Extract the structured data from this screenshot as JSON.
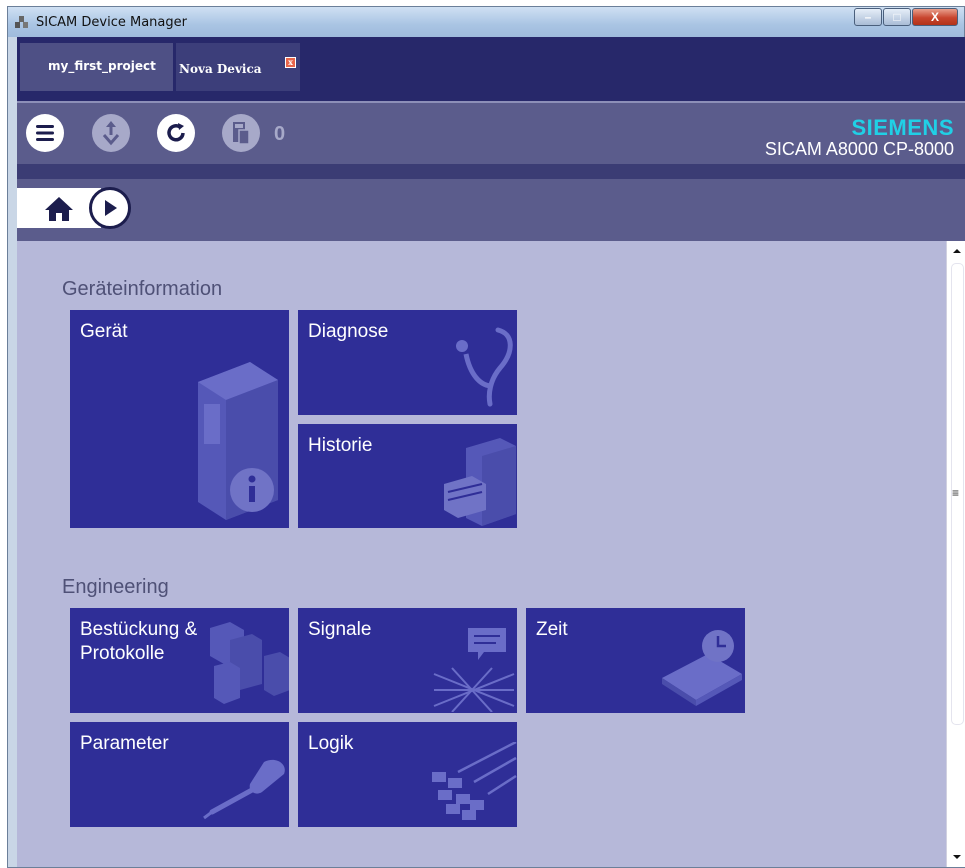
{
  "window": {
    "title": "SICAM Device Manager",
    "close_glyph": "X",
    "minimize_glyph": "–",
    "maximize_glyph": "□"
  },
  "tabs": [
    {
      "label": "my_first_project"
    },
    {
      "label": "Nova Devica",
      "close_glyph": "x"
    }
  ],
  "toolbar": {
    "icons": [
      "menu-icon",
      "download-icon",
      "refresh-icon",
      "device-load-icon"
    ],
    "count": "0"
  },
  "brand": {
    "logo": "SIEMENS",
    "model": "SICAM A8000 CP-8000"
  },
  "sections": [
    {
      "title": "Geräteinformation",
      "tiles": [
        "Gerät",
        "Diagnose",
        "Historie"
      ]
    },
    {
      "title": "Engineering",
      "tiles": [
        "Bestückung & Protokolle",
        "Signale",
        "Zeit",
        "Parameter",
        "Logik"
      ]
    }
  ],
  "colors": {
    "tile": "#2f2e97",
    "content_bg": "#b6b8d9",
    "header": "#5b5c8c",
    "brand_accent": "#20d0e6"
  }
}
